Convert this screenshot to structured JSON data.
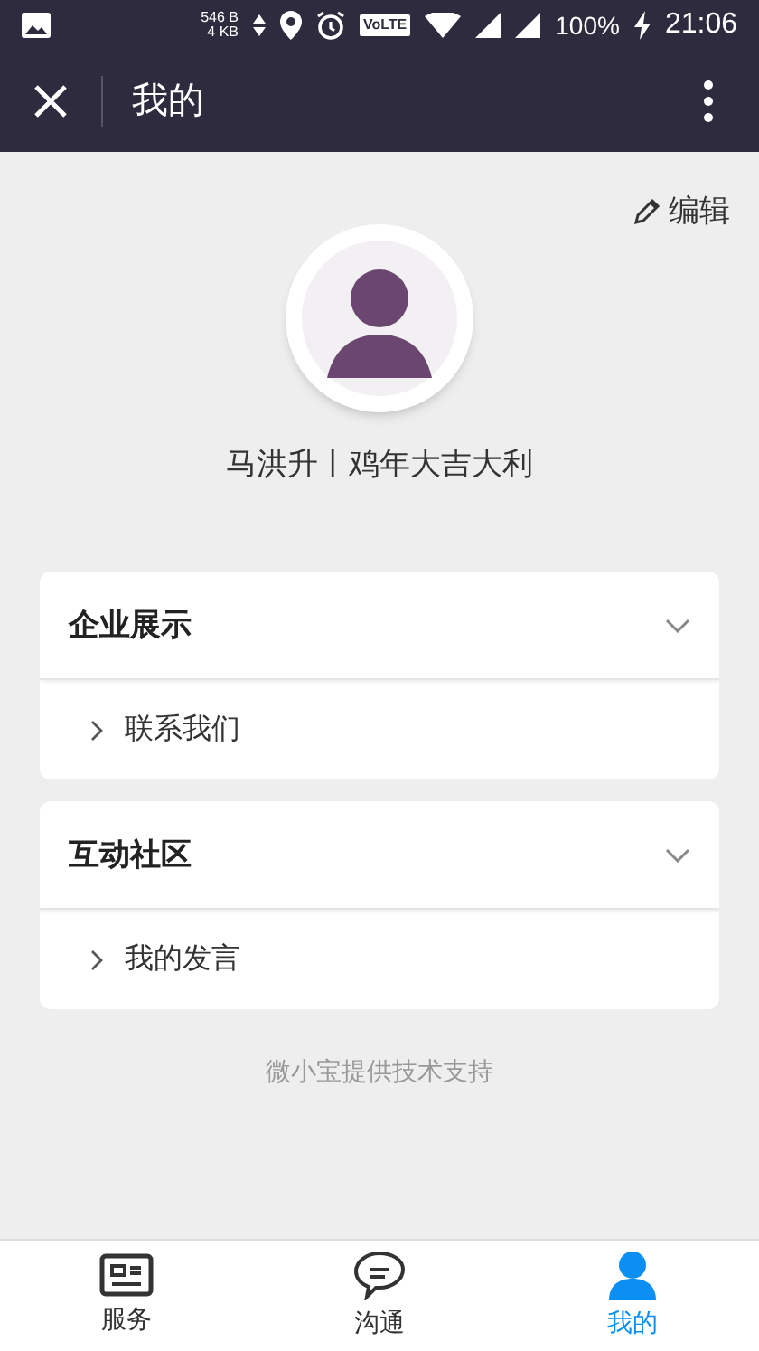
{
  "status_bar": {
    "net_up": "546 B",
    "net_down": "4 KB",
    "volte": "VoLTE",
    "battery": "100%",
    "time": "21:06"
  },
  "header": {
    "title": "我的"
  },
  "profile": {
    "edit": "编辑",
    "name": "马洪升丨鸡年大吉大利"
  },
  "sections": [
    {
      "title": "企业展示",
      "expanded": true,
      "items": [
        "联系我们"
      ]
    },
    {
      "title": "互动社区",
      "expanded": true,
      "items": [
        "我的发言"
      ]
    }
  ],
  "footer": "微小宝提供技术支持",
  "nav": [
    {
      "label": "服务",
      "kind": "service",
      "selected": false
    },
    {
      "label": "沟通",
      "kind": "chat",
      "selected": false
    },
    {
      "label": "我的",
      "kind": "me",
      "selected": true
    }
  ]
}
